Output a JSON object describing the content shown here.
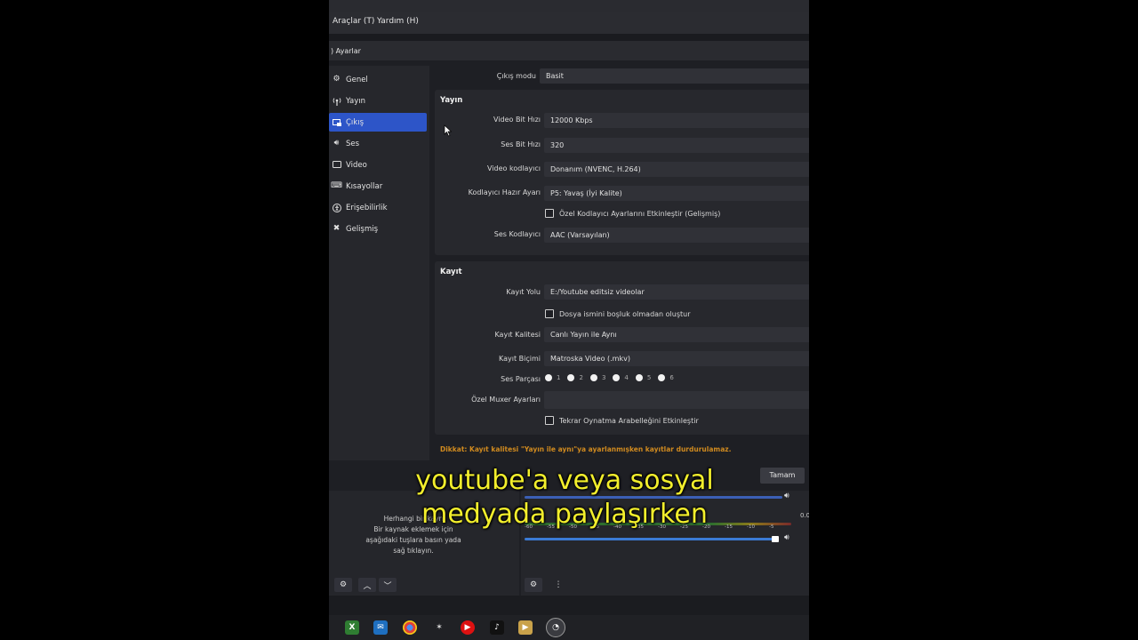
{
  "menubar": {
    "items": [
      "Araçlar (T)",
      "Yardım (H)"
    ]
  },
  "dialog": {
    "title": "Ayarlar"
  },
  "sidebar": {
    "items": [
      {
        "label": "Genel",
        "icon": "gear-icon"
      },
      {
        "label": "Yayın",
        "icon": "antenna-icon"
      },
      {
        "label": "Çıkış",
        "icon": "output-icon",
        "active": true
      },
      {
        "label": "Ses",
        "icon": "speaker-icon"
      },
      {
        "label": "Video",
        "icon": "monitor-icon"
      },
      {
        "label": "Kısayollar",
        "icon": "keyboard-icon"
      },
      {
        "label": "Erişebilirlik",
        "icon": "accessibility-icon"
      },
      {
        "label": "Gelişmiş",
        "icon": "tools-icon"
      }
    ]
  },
  "output_mode": {
    "label": "Çıkış modu",
    "value": "Basit"
  },
  "stream": {
    "title": "Yayın",
    "video_bitrate": {
      "label": "Video Bit Hızı",
      "value": "12000 Kbps"
    },
    "audio_bitrate": {
      "label": "Ses Bit Hızı",
      "value": "320"
    },
    "video_encoder": {
      "label": "Video kodlayıcı",
      "value": "Donanım (NVENC, H.264)"
    },
    "encoder_preset": {
      "label": "Kodlayıcı Hazır Ayarı",
      "value": "P5: Yavaş (İyi Kalite)"
    },
    "custom_encoder_checkbox": "Özel Kodlayıcı Ayarlarını Etkinleştir (Gelişmiş)",
    "audio_encoder": {
      "label": "Ses Kodlayıcı",
      "value": "AAC (Varsayılan)"
    }
  },
  "recording": {
    "title": "Kayıt",
    "path": {
      "label": "Kayıt Yolu",
      "value": "E:/Youtube editsiz videolar"
    },
    "no_space_checkbox": "Dosya ismini boşluk olmadan oluştur",
    "quality": {
      "label": "Kayıt Kalitesi",
      "value": "Canlı Yayın ile Aynı"
    },
    "format": {
      "label": "Kayıt Biçimi",
      "value": "Matroska Video (.mkv)"
    },
    "tracks": {
      "label": "Ses Parçası",
      "options": [
        "1",
        "2",
        "3",
        "4",
        "5",
        "6"
      ]
    },
    "muxer": {
      "label": "Özel Muxer Ayarları",
      "value": ""
    },
    "replay_checkbox": "Tekrar Oynatma Arabelleğini Etkinleştir"
  },
  "warning": "Dikkat: Kayıt kalitesi \"Yayın ile aynı\"ya ayarlanmışken kayıtlar durdurulamaz.",
  "ok_button": "Tamam",
  "sources_empty": {
    "line1": "Herhangi bir kayn",
    "line2": "Bir kaynak eklemek için",
    "line3": "aşağıdaki tuşlara basın yada",
    "line4": "sağ tıklayın."
  },
  "mixer": {
    "ticks": [
      "-60",
      "-55",
      "-50",
      "-45",
      "-40",
      "-35",
      "-30",
      "-25",
      "-20",
      "-15",
      "-10",
      "-5"
    ],
    "db_readout": "0.0"
  },
  "caption": {
    "line1": "youtube'a veya sosyal",
    "line2": "medyada paylaşırken"
  },
  "colors": {
    "accent": "#2d55c8",
    "warning": "#d08a1f",
    "caption": "#f2ee2c"
  }
}
